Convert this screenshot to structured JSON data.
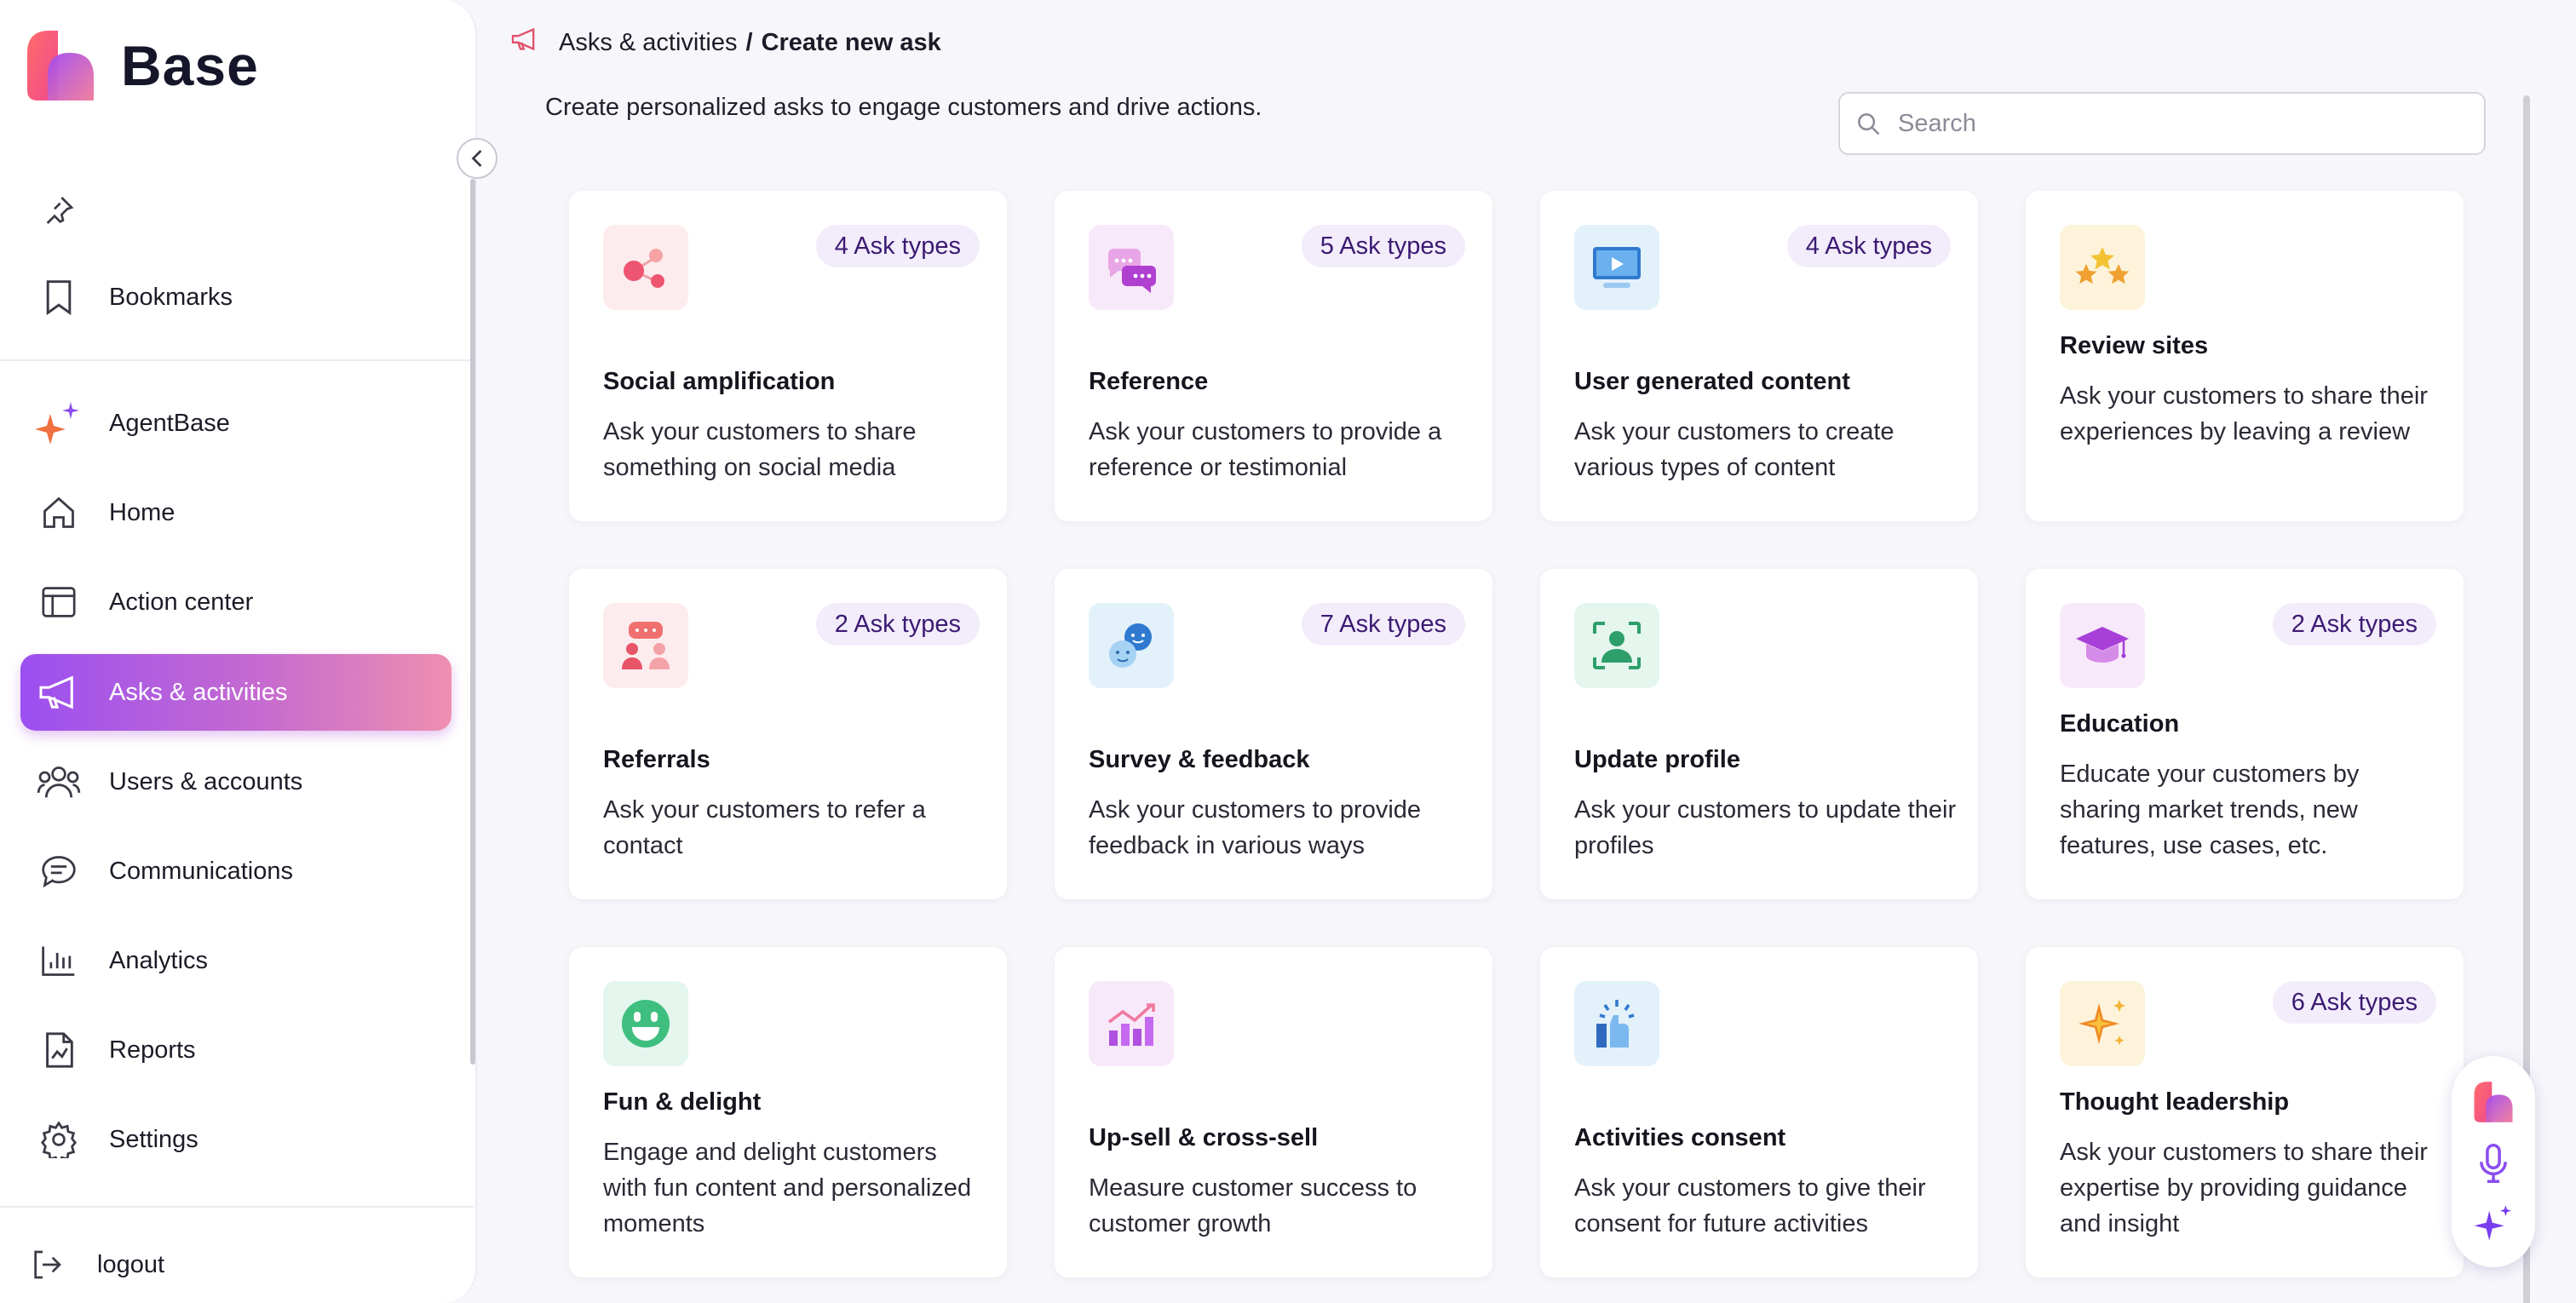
{
  "brand": {
    "name": "Base"
  },
  "sidebar": {
    "items": [
      {
        "id": "pin",
        "label": "",
        "icon": "pin-icon"
      },
      {
        "id": "bookmarks",
        "label": "Bookmarks",
        "icon": "bookmark-icon"
      },
      {
        "id": "agentbase",
        "label": "AgentBase",
        "icon": "sparkle-icon"
      },
      {
        "id": "home",
        "label": "Home",
        "icon": "home-icon"
      },
      {
        "id": "action-center",
        "label": "Action center",
        "icon": "layout-icon"
      },
      {
        "id": "asks",
        "label": "Asks & activities",
        "icon": "megaphone-icon",
        "active": true
      },
      {
        "id": "users",
        "label": "Users & accounts",
        "icon": "users-icon"
      },
      {
        "id": "communications",
        "label": "Communications",
        "icon": "chat-icon"
      },
      {
        "id": "analytics",
        "label": "Analytics",
        "icon": "bar-chart-icon"
      },
      {
        "id": "reports",
        "label": "Reports",
        "icon": "report-icon"
      },
      {
        "id": "settings",
        "label": "Settings",
        "icon": "gear-icon"
      }
    ],
    "logout": "logout"
  },
  "header": {
    "breadcrumb_first": "Asks & activities",
    "breadcrumb_sep": "/",
    "breadcrumb_last": "Create new ask",
    "subtitle": "Create personalized asks to engage customers and drive actions."
  },
  "search": {
    "placeholder": "Search",
    "value": ""
  },
  "cards": [
    {
      "title": "Social amplification",
      "desc": "Ask your customers to share something on social media",
      "badge": "4 Ask types",
      "icon": "share-icon"
    },
    {
      "title": "Reference",
      "desc": "Ask your customers to provide a reference or testimonial",
      "badge": "5 Ask types",
      "icon": "chat-bubbles-icon"
    },
    {
      "title": "User generated content",
      "desc": "Ask your customers to create various types of content",
      "badge": "4 Ask types",
      "icon": "video-icon"
    },
    {
      "title": "Review sites",
      "desc": "Ask your customers to share their experiences by leaving a review",
      "badge": "",
      "icon": "stars-icon"
    },
    {
      "title": "Referrals",
      "desc": "Ask your customers to refer a contact",
      "badge": "2 Ask types",
      "icon": "referral-icon"
    },
    {
      "title": "Survey & feedback",
      "desc": "Ask your customers to provide feedback in various ways",
      "badge": "7 Ask types",
      "icon": "feedback-icon"
    },
    {
      "title": "Update profile",
      "desc": "Ask your customers to update their profiles",
      "badge": "",
      "icon": "profile-scan-icon"
    },
    {
      "title": "Education",
      "desc": "Educate your customers by sharing market trends, new features, use cases, etc.",
      "badge": "2 Ask types",
      "icon": "graduation-cap-icon"
    },
    {
      "title": "Fun & delight",
      "desc": "Engage and delight customers with fun content and personalized moments",
      "badge": "",
      "icon": "smiley-icon"
    },
    {
      "title": "Up-sell & cross-sell",
      "desc": "Measure customer success to customer growth",
      "badge": "",
      "icon": "growth-chart-icon"
    },
    {
      "title": "Activities consent",
      "desc": "Ask your customers to give their consent for future activities",
      "badge": "",
      "icon": "thumbs-up-icon"
    },
    {
      "title": "Thought leadership",
      "desc": "Ask your customers to share their expertise by providing guidance and insight",
      "badge": "6 Ask types",
      "icon": "spark-icon"
    }
  ],
  "colors": {
    "accent_start": "#9b4ff0",
    "accent_end": "#ef8fb0",
    "badge_bg": "#f3ecfb",
    "badge_text": "#3b1a72"
  }
}
